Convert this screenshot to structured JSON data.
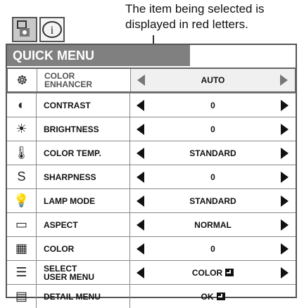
{
  "annotation": {
    "line1": "The item being selected is",
    "line2": "displayed in red letters."
  },
  "tabs": [
    {
      "icon": "projector-menu-icon"
    },
    {
      "icon": "info-icon",
      "glyph": "i"
    }
  ],
  "menu": {
    "title": "QUICK MENU",
    "rows": [
      {
        "icon": "color-enhancer-icon",
        "glyph": "☸",
        "label": [
          "COLOR",
          "ENHANCER"
        ],
        "value": "AUTO",
        "arrows": true,
        "selected": true
      },
      {
        "icon": "contrast-icon",
        "glyph": "◐",
        "label": [
          "CONTRAST"
        ],
        "value": "0",
        "arrows": true
      },
      {
        "icon": "brightness-icon",
        "glyph": "☀",
        "label": [
          "BRIGHTNESS"
        ],
        "value": "0",
        "arrows": true
      },
      {
        "icon": "color-temp-icon",
        "glyph": "🌡",
        "label": [
          "COLOR TEMP."
        ],
        "value": "STANDARD",
        "arrows": true
      },
      {
        "icon": "sharpness-icon",
        "glyph": "S",
        "label": [
          "SHARPNESS"
        ],
        "value": "0",
        "arrows": true
      },
      {
        "icon": "lamp-mode-icon",
        "glyph": "💡",
        "label": [
          "LAMP MODE"
        ],
        "value": "STANDARD",
        "arrows": true
      },
      {
        "icon": "aspect-icon",
        "glyph": "▭",
        "label": [
          "ASPECT"
        ],
        "value": "NORMAL",
        "arrows": true
      },
      {
        "icon": "color-icon",
        "glyph": "▦",
        "label": [
          "COLOR"
        ],
        "value": "0",
        "arrows": true
      },
      {
        "icon": "select-user-menu-icon",
        "glyph": "☰",
        "label": [
          "SELECT",
          "USER MENU"
        ],
        "value": "COLOR",
        "enter": true,
        "arrows": true
      },
      {
        "icon": "detail-menu-icon",
        "glyph": "▤",
        "label": [
          "DETAIL MENU"
        ],
        "value": "OK",
        "enter": true,
        "arrows": false
      }
    ]
  }
}
